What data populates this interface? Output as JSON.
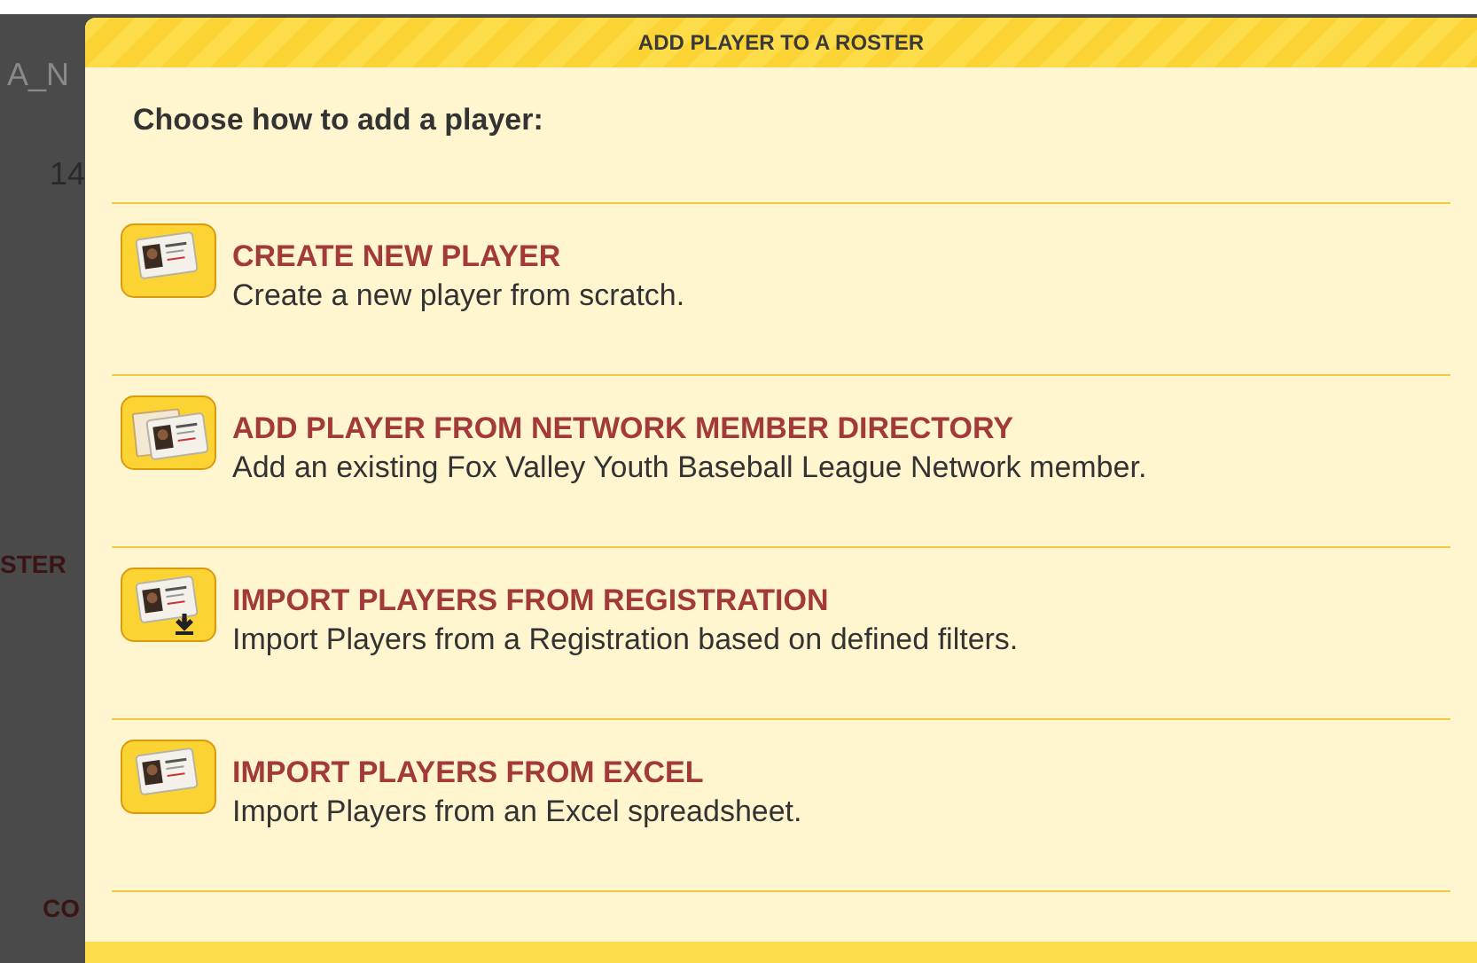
{
  "background": {
    "texts": [
      {
        "kind": "title",
        "text": "A_N"
      },
      {
        "kind": "value",
        "text": "14"
      },
      {
        "kind": "tab",
        "text": "STER"
      },
      {
        "kind": "heading",
        "text": "CO"
      }
    ]
  },
  "dialog": {
    "title": "ADD PLAYER TO A ROSTER",
    "prompt": "Choose how to add a player:",
    "options": [
      {
        "kind": "card",
        "title": "CREATE NEW PLAYER",
        "description": "Create a new player from scratch."
      },
      {
        "kind": "directory",
        "title": "ADD PLAYER FROM NETWORK MEMBER DIRECTORY",
        "description": "Add an existing Fox Valley Youth Baseball League Network member."
      },
      {
        "kind": "download",
        "title": "IMPORT PLAYERS FROM REGISTRATION",
        "description": "Import Players from a Registration based on defined filters."
      },
      {
        "kind": "card",
        "title": "IMPORT PLAYERS FROM EXCEL",
        "description": "Import Players from an Excel spreadsheet."
      }
    ]
  }
}
